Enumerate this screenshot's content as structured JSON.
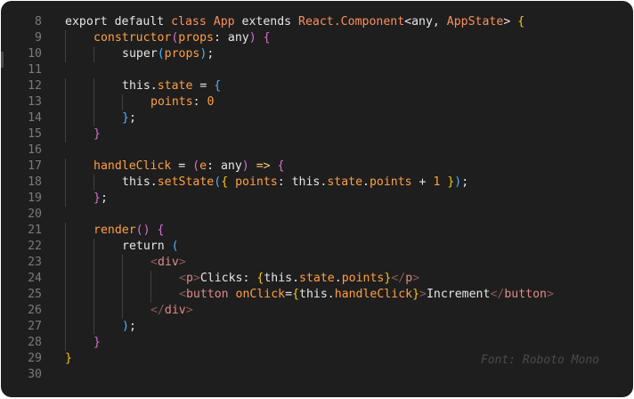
{
  "editor": {
    "font_label": "Font: Roboto Mono",
    "colors": {
      "background": "#1e1e1e",
      "line_number": "#7a7a7a",
      "text": "#e6e6e6",
      "keyword_class": "#fd8f5c",
      "bracket_yellow": "#f5c518",
      "bracket_magenta": "#d670d6",
      "bracket_blue": "#4fb3ff",
      "method": "#ff9f43",
      "jsx_tag": "#e08a8a"
    },
    "lines": [
      {
        "n": "8",
        "indent": 0,
        "tokens": [
          [
            "t-kw",
            "export default "
          ],
          [
            "t-class",
            "class"
          ],
          [
            "t-plain",
            " "
          ],
          [
            "t-type",
            "App"
          ],
          [
            "t-kw",
            " extends "
          ],
          [
            "t-type",
            "React.Component"
          ],
          [
            "t-plain",
            "<any, "
          ],
          [
            "t-type",
            "AppState"
          ],
          [
            "t-plain",
            "> "
          ],
          [
            "t-b1",
            "{"
          ]
        ]
      },
      {
        "n": "9",
        "indent": 1,
        "tokens": [
          [
            "t-method",
            "constructor"
          ],
          [
            "t-b2",
            "("
          ],
          [
            "t-prop",
            "props"
          ],
          [
            "t-plain",
            ": any"
          ],
          [
            "t-b2",
            ")"
          ],
          [
            "t-plain",
            " "
          ],
          [
            "t-b2",
            "{"
          ]
        ]
      },
      {
        "n": "10",
        "indent": 2,
        "tokens": [
          [
            "t-plain",
            "super"
          ],
          [
            "t-b3",
            "("
          ],
          [
            "t-prop",
            "props"
          ],
          [
            "t-b3",
            ")"
          ],
          [
            "t-plain",
            ";"
          ]
        ]
      },
      {
        "n": "11",
        "indent": 0,
        "tokens": []
      },
      {
        "n": "12",
        "indent": 2,
        "tokens": [
          [
            "t-plain",
            "this."
          ],
          [
            "t-prop",
            "state"
          ],
          [
            "t-plain",
            " = "
          ],
          [
            "t-b3",
            "{"
          ]
        ]
      },
      {
        "n": "13",
        "indent": 3,
        "tokens": [
          [
            "t-prop",
            "points"
          ],
          [
            "t-plain",
            ": "
          ],
          [
            "t-num",
            "0"
          ]
        ]
      },
      {
        "n": "14",
        "indent": 2,
        "tokens": [
          [
            "t-b3",
            "}"
          ],
          [
            "t-plain",
            ";"
          ]
        ]
      },
      {
        "n": "15",
        "indent": 1,
        "tokens": [
          [
            "t-b2",
            "}"
          ]
        ]
      },
      {
        "n": "16",
        "indent": 0,
        "tokens": []
      },
      {
        "n": "17",
        "indent": 1,
        "tokens": [
          [
            "t-method",
            "handleClick"
          ],
          [
            "t-plain",
            " = "
          ],
          [
            "t-b2",
            "("
          ],
          [
            "t-prop",
            "e"
          ],
          [
            "t-plain",
            ": any"
          ],
          [
            "t-b2",
            ")"
          ],
          [
            "t-plain",
            " "
          ],
          [
            "t-arrow",
            "=>"
          ],
          [
            "t-plain",
            " "
          ],
          [
            "t-b2",
            "{"
          ]
        ]
      },
      {
        "n": "18",
        "indent": 2,
        "tokens": [
          [
            "t-plain",
            "this."
          ],
          [
            "t-method",
            "setState"
          ],
          [
            "t-b3",
            "("
          ],
          [
            "t-b1",
            "{"
          ],
          [
            "t-plain",
            " "
          ],
          [
            "t-prop",
            "points"
          ],
          [
            "t-plain",
            ": this."
          ],
          [
            "t-prop",
            "state"
          ],
          [
            "t-plain",
            "."
          ],
          [
            "t-prop",
            "points"
          ],
          [
            "t-plain",
            " + "
          ],
          [
            "t-num",
            "1"
          ],
          [
            "t-plain",
            " "
          ],
          [
            "t-b1",
            "}"
          ],
          [
            "t-b3",
            ")"
          ],
          [
            "t-plain",
            ";"
          ]
        ]
      },
      {
        "n": "19",
        "indent": 1,
        "tokens": [
          [
            "t-b2",
            "}"
          ],
          [
            "t-plain",
            ";"
          ]
        ]
      },
      {
        "n": "20",
        "indent": 0,
        "tokens": []
      },
      {
        "n": "21",
        "indent": 1,
        "tokens": [
          [
            "t-method",
            "render"
          ],
          [
            "t-b2",
            "()"
          ],
          [
            "t-plain",
            " "
          ],
          [
            "t-b2",
            "{"
          ]
        ]
      },
      {
        "n": "22",
        "indent": 2,
        "tokens": [
          [
            "t-plain",
            "return "
          ],
          [
            "t-b3",
            "("
          ]
        ]
      },
      {
        "n": "23",
        "indent": 3,
        "tokens": [
          [
            "t-tagb",
            "<"
          ],
          [
            "t-tag",
            "div"
          ],
          [
            "t-tagb",
            ">"
          ]
        ]
      },
      {
        "n": "24",
        "indent": 4,
        "tokens": [
          [
            "t-tagb",
            "<"
          ],
          [
            "t-tag",
            "p"
          ],
          [
            "t-tagb",
            ">"
          ],
          [
            "t-jsx",
            "Clicks: "
          ],
          [
            "t-b1",
            "{"
          ],
          [
            "t-plain",
            "this."
          ],
          [
            "t-prop",
            "state"
          ],
          [
            "t-plain",
            "."
          ],
          [
            "t-prop",
            "points"
          ],
          [
            "t-b1",
            "}"
          ],
          [
            "t-tagb",
            "</"
          ],
          [
            "t-tag",
            "p"
          ],
          [
            "t-tagb",
            ">"
          ]
        ]
      },
      {
        "n": "25",
        "indent": 4,
        "tokens": [
          [
            "t-tagb",
            "<"
          ],
          [
            "t-tag",
            "button"
          ],
          [
            "t-plain",
            " "
          ],
          [
            "t-attr",
            "onClick"
          ],
          [
            "t-plain",
            "="
          ],
          [
            "t-b1",
            "{"
          ],
          [
            "t-plain",
            "this."
          ],
          [
            "t-method",
            "handleClick"
          ],
          [
            "t-b1",
            "}"
          ],
          [
            "t-tagb",
            ">"
          ],
          [
            "t-jsx",
            "Increment"
          ],
          [
            "t-tagb",
            "</"
          ],
          [
            "t-tag",
            "button"
          ],
          [
            "t-tagb",
            ">"
          ]
        ]
      },
      {
        "n": "26",
        "indent": 3,
        "tokens": [
          [
            "t-tagb",
            "</"
          ],
          [
            "t-tag",
            "div"
          ],
          [
            "t-tagb",
            ">"
          ]
        ]
      },
      {
        "n": "27",
        "indent": 2,
        "tokens": [
          [
            "t-b3",
            ")"
          ],
          [
            "t-plain",
            ";"
          ]
        ]
      },
      {
        "n": "28",
        "indent": 1,
        "tokens": [
          [
            "t-b2",
            "}"
          ]
        ]
      },
      {
        "n": "29",
        "indent": 0,
        "tokens": [
          [
            "t-b1",
            "}"
          ]
        ]
      },
      {
        "n": "30",
        "indent": 0,
        "tokens": []
      }
    ]
  }
}
